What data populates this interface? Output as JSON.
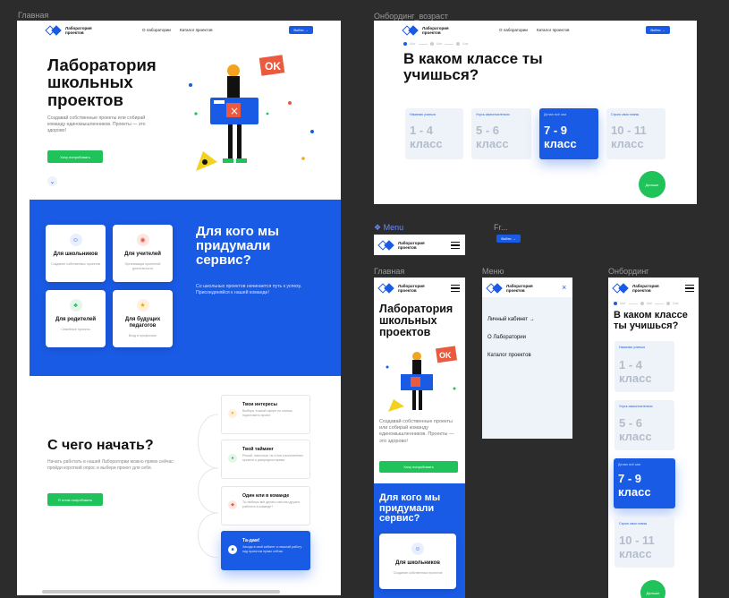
{
  "colors": {
    "brand": "#1a5be6",
    "green": "#1fc35a",
    "canvas": "#2c2c2c"
  },
  "frames": {
    "home": "Главная",
    "onb_age": "Онбординг_возраст",
    "menu_comp": "Menu",
    "fr": "Fr...",
    "m_home": "Главная",
    "m_menu": "Меню",
    "m_onb": "Онбординг"
  },
  "logo": {
    "text": "Лаборатория проектов"
  },
  "nav": {
    "about": "О лаборатории",
    "catalog": "Каталог проектов",
    "login": "Войти →"
  },
  "hero": {
    "title": "Лаборатория школьных проектов",
    "subtitle": "Создавай собственные проекты или собирай команду единомышленников. Проекты — это здорово!",
    "cta": "Хочу попробовать",
    "scroll": "⌄"
  },
  "figure": {
    "badge": "OK"
  },
  "who": {
    "title": "Для кого мы придумали сервис?",
    "text": "Со школьных проектов начинается путь к успеху. Присоединяйся к нашей команде!",
    "cards": [
      {
        "title": "Для школьников",
        "desc": "Создание собственных проектов",
        "icon": "smile-icon",
        "color": "#e8efff",
        "fg": "#1a5be6"
      },
      {
        "title": "Для учителей",
        "desc": "Организация проектной деятельности",
        "icon": "teacher-icon",
        "color": "#fde7e3",
        "fg": "#e95a3f"
      },
      {
        "title": "Для родителей",
        "desc": "Семейные проекты",
        "icon": "family-icon",
        "color": "#e4f6ea",
        "fg": "#1fc35a"
      },
      {
        "title": "Для будущих педагогов",
        "desc": "Вход в профессию",
        "icon": "future-icon",
        "color": "#fff2dd",
        "fg": "#f2a420"
      }
    ]
  },
  "start": {
    "title": "С чего начать?",
    "text": "Начать работать в нашей Лаборатории можно прямо сейчас: пройди короткий опрос и выбери проект для себя.",
    "cta": "Я готов попробовать",
    "steps": [
      {
        "title": "Твои интересы",
        "desc": "Выбери, в какой сфере ты хочешь подготовить проект",
        "color": "#fff2dd"
      },
      {
        "title": "Твой тайминг",
        "desc": "Решай, насколько ты готов к выполнению проекта и распредели время",
        "color": "#e4f6ea"
      },
      {
        "title": "Один или в команде",
        "desc": "Ты любишь всё делать сам или дружно работать в команде?",
        "color": "#fde7e3"
      },
      {
        "title": "Та-дам!",
        "desc": "Заходи в свой кабинет и начинай работу над проектом прямо сейчас",
        "color": "#ffffff"
      }
    ]
  },
  "onboarding": {
    "steps": [
      "Шаг",
      "Шаг",
      "Шаг"
    ],
    "title": "В каком классе ты учишься?",
    "next": "Дальше",
    "grades": [
      {
        "small": "Начинаю учиться",
        "big1": "1 - 4",
        "big2": "класс",
        "selected": false
      },
      {
        "small": "Учусь самостоятельно",
        "big1": "5 - 6",
        "big2": "класс",
        "selected": false
      },
      {
        "small": "Делаю всё сам",
        "big1": "7 - 9",
        "big2": "класс",
        "selected": true
      },
      {
        "small": "Строю свои планы",
        "big1": "10 - 11",
        "big2": "класс",
        "selected": false
      }
    ]
  },
  "menu": {
    "items": [
      "Личный кабинет →",
      "О Лаборатории",
      "Каталог проектов"
    ]
  },
  "mobile": {
    "who_title": "Для кого мы придумали сервис?",
    "card_title": "Для школьников",
    "card_desc": "Создание собственных проектов"
  }
}
